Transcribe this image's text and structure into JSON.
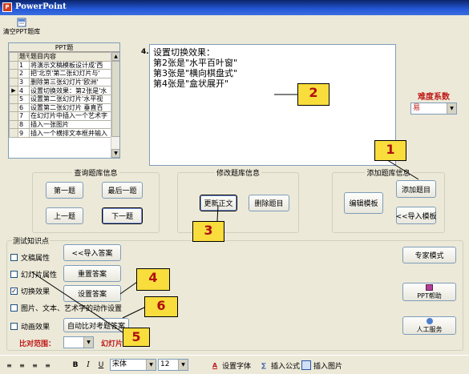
{
  "window": {
    "title": "PowerPoint"
  },
  "toolbar": {
    "clear_label": "清空PPT题库"
  },
  "question_grid": {
    "header": "PPT题",
    "columns": [
      "题号",
      "题目内容"
    ],
    "rows": [
      {
        "num": "1",
        "text": "将演示文稿模板设计成'西",
        "selected": false
      },
      {
        "num": "2",
        "text": "把'北京'第二张幻灯片与'",
        "selected": false
      },
      {
        "num": "3",
        "text": "删除第三张幻灯片'欧洲'",
        "selected": false
      },
      {
        "num": "4",
        "text": "设置切换效果：第2张是'水",
        "selected": true
      },
      {
        "num": "5",
        "text": "设置第二张幻灯片'水平视",
        "selected": false
      },
      {
        "num": "6",
        "text": "设置第二张幻灯片 垂直百",
        "selected": false
      },
      {
        "num": "7",
        "text": "在幻灯片中插入一个艺术字",
        "selected": false
      },
      {
        "num": "8",
        "text": "插入一张图片",
        "selected": false
      },
      {
        "num": "9",
        "text": "插入一个横排文本框并输入",
        "selected": false
      }
    ]
  },
  "editor": {
    "number": "4.",
    "lines": [
      "设置切换效果：",
      "第2张是\"水平百叶窗\"",
      "第3张是\"横向棋盘式\"",
      "第4张是\"盒状展开\""
    ]
  },
  "difficulty": {
    "label": "难度系数",
    "value": "易"
  },
  "query_group": {
    "title": "查询题库信息",
    "first": "第一题",
    "last": "最后一题",
    "prev": "上一题",
    "next": "下一题"
  },
  "modify_group": {
    "title": "修改题库信息",
    "update": "更新正文",
    "delete": "删除题目"
  },
  "add_group": {
    "title": "添加题库信息",
    "edit_template": "编辑模板",
    "add_question": "添加题目",
    "import_template": "<<导入模板"
  },
  "knowledge": {
    "title": "测试知识点",
    "checkboxes": [
      {
        "label": "文稿属性",
        "checked": false
      },
      {
        "label": "幻灯片属性",
        "checked": false
      },
      {
        "label": "切换效果",
        "checked": true
      },
      {
        "label": "图片、文本、艺术字的动作设置",
        "checked": false
      },
      {
        "label": "动画效果",
        "checked": false
      }
    ],
    "import_answer": "<<导入答案",
    "reset_answer": "重置答案",
    "set_answer": "设置答案",
    "auto_compare": "自动比对考题答案",
    "compare_range_label": "比对范围：",
    "slide_label": "幻灯片"
  },
  "right_buttons": {
    "expert": "专家模式",
    "ppt_help": "PPT帮助",
    "manual": "人工服务"
  },
  "status_toolbar": {
    "font_name": "宋体",
    "font_size": "12",
    "bold": "B",
    "italic": "I",
    "underline": "U",
    "set_font": "设置字体",
    "insert_formula": "插入公式",
    "insert_image": "插入图片"
  },
  "callouts": [
    "1",
    "2",
    "3",
    "4",
    "5",
    "6"
  ],
  "colors": {
    "callout_bg": "#f8dd3c",
    "callout_text": "#b01010",
    "title_bar": "#2458d6",
    "label_red": "#c01818"
  }
}
